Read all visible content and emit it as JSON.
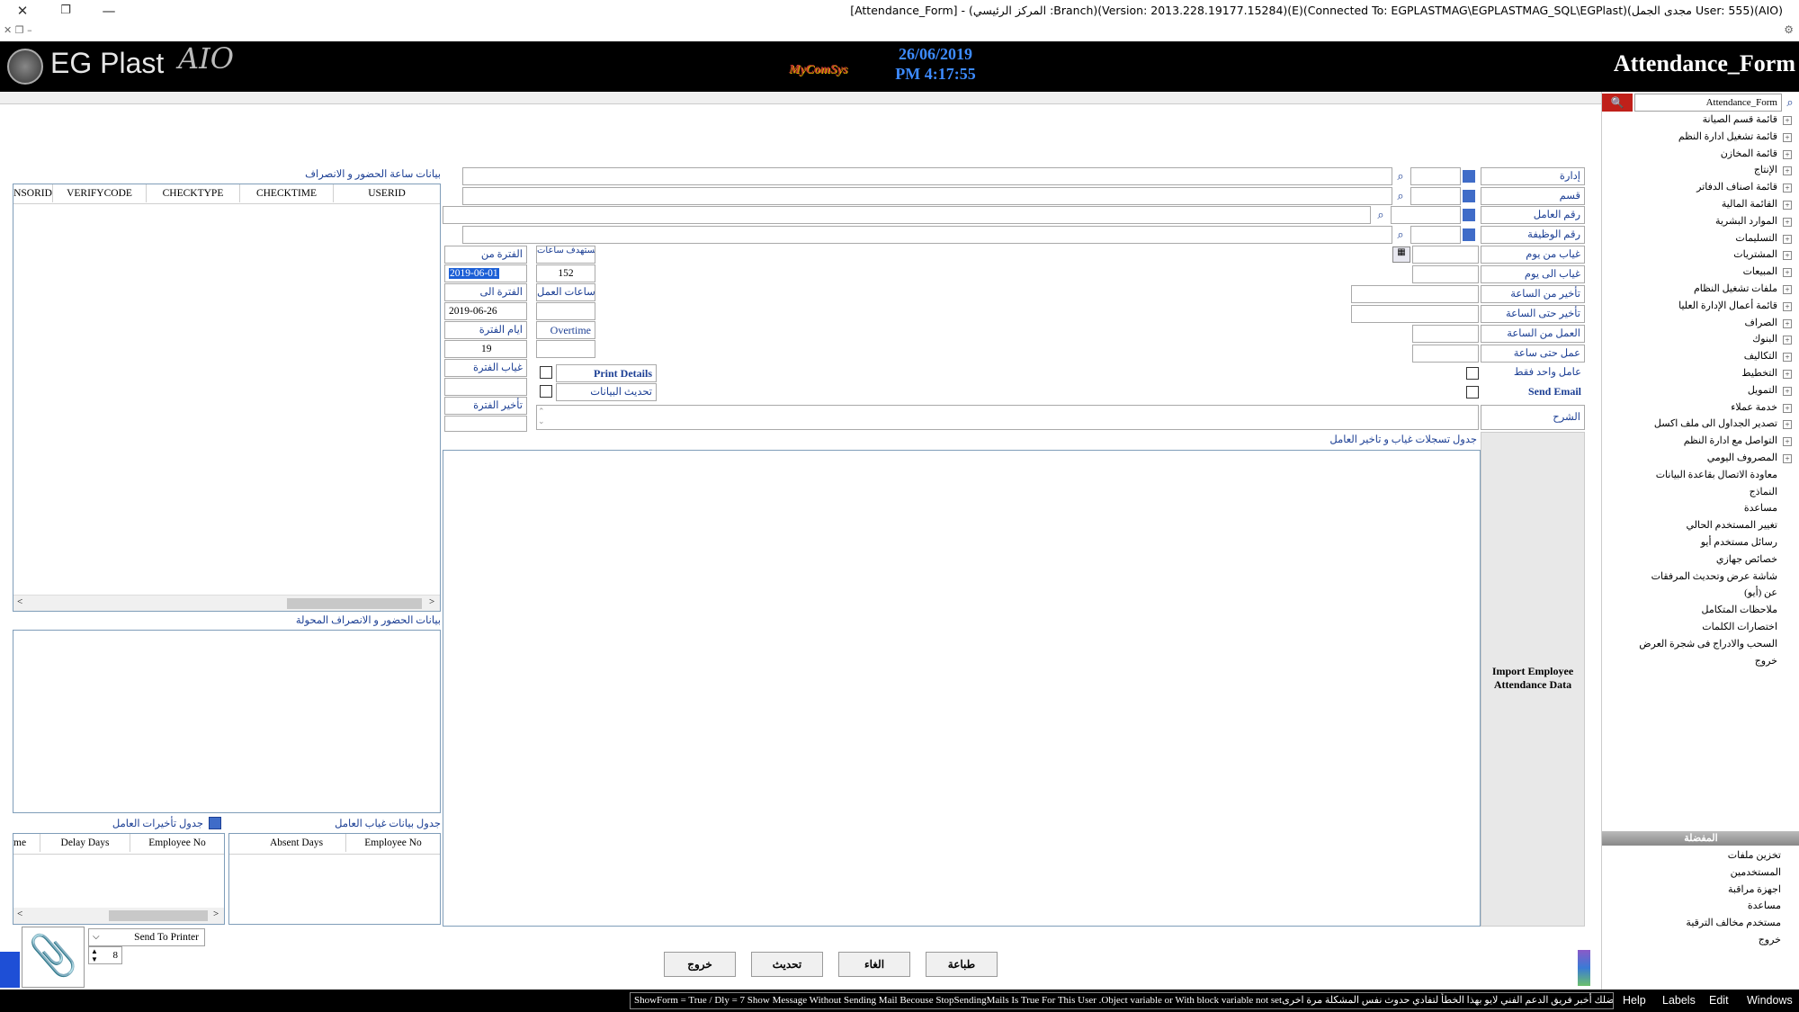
{
  "window": {
    "title": "[Attendance_Form] - (المركز الرئيسي :Branch)(Version: 2013.228.19177.15284)(E)(Connected To: EGPLASTMAG\\EGPLASTMAG_SQL\\EGPlast)(مجدى الجمل User: 555)(AIO)"
  },
  "header": {
    "logo": "EG Plast",
    "logo_suffix": "AIO",
    "brand": "MyComSys",
    "date": "26/06/2019",
    "time": "PM 4:17:55",
    "form_title": "Attendance_Form"
  },
  "left": {
    "att_title": "بيانات ساعة الحضور و الانصراف",
    "att_columns": [
      "NSORID",
      "VERIFYCODE",
      "CHECKTYPE",
      "CHECKTIME",
      "USERID"
    ],
    "transferred_title": "بيانات الحضور و الانصراف المحولة",
    "delays_title": "جدول تأخيرات العامل",
    "delays_columns": [
      "me",
      "Delay Days",
      "Employee No"
    ],
    "absence_title": "جدول بيانات غياب العامل",
    "absence_columns": [
      "Absent Days",
      "Employee No"
    ]
  },
  "form": {
    "labels": {
      "department": "إدارة",
      "section": "قسم",
      "employee_no": "رقم العامل",
      "job_no": "رقم الوظيفة",
      "absent_from": "غياب من يوم",
      "absent_to": "غياب الى يوم",
      "delay_from": "تأخير من الساعة",
      "delay_to": "تأخير حتى الساعة",
      "work_from": "العمل من الساعة",
      "work_to": "عمل حتى ساعة",
      "single_worker": "عامل واحد فقط",
      "send_email": "Send Email",
      "explanation": "الشرح"
    },
    "mid": {
      "period_from_label": "الفترة من",
      "period_from": "2019-06-01",
      "period_to_label": "الفترة الى",
      "period_to": "2019-06-26",
      "period_days_label": "ايام الفترة",
      "period_days": "19",
      "period_absence_label": "غياب الفترة",
      "period_delay_label": "تأخير الفترة",
      "required_hours_label": "مستهدف ساعات",
      "required_hours": "152",
      "work_hours_label": "ساعات العمل",
      "overtime_label": "Overtime",
      "print_details": "Print Details",
      "update_data": "تحديث البيانات"
    },
    "grid_title": "جدول تسجلات غياب و تاخير العامل",
    "import_label": "Import Employee Attendance Data"
  },
  "buttons": {
    "exit": "خروج",
    "refresh": "تحديث",
    "cancel": "الغاء",
    "print": "طباعة",
    "send_to_printer": "Send To Printer",
    "copies": "8"
  },
  "tree": {
    "search_value": "Attendance_Form",
    "items": [
      "قائمة قسم الصيانة",
      "قائمة تشغيل ادارة النظم",
      "قائمة المخازن",
      "الإنتاج",
      "قائمة اصناف الدفاتر",
      "القائمة المالية",
      "الموارد البشرية",
      "التسليمات",
      "المشتريات",
      "المبيعات",
      "ملفات تشغيل النظام",
      "قائمة أعمال الإدارة العليا",
      "الصراف",
      "البنوك",
      "التكاليف",
      "التخطيط",
      "التمويل",
      "خدمة عملاء",
      "تصدير الجداول الى ملف اكسل",
      "التواصل مع ادارة النظم",
      "المصروف اليومي",
      "معاودة الاتصال بقاعدة البيانات",
      "النماذج",
      "مساعدة",
      "تغيير المستخدم الحالي",
      "رسائل مستخدم أيو",
      "خصائص جهازي",
      "شاشة عرض وتحديث المرفقات",
      "عن (أيو)",
      "ملاحظات المتكامل",
      "اختصارات الكلمات",
      "السحب والادراج فى شجرة العرض",
      "خروج"
    ],
    "favorites_title": "المفضلة",
    "favorites": [
      "تخزين ملفات",
      "المستخدمين",
      "اجهزة مراقبة",
      "مساعدة",
      "مستخدم مخالف الترقية",
      "خروج"
    ]
  },
  "status": {
    "message": "ShowForm = True / Dly = 7 Show Message Without Sending Mail Becouse StopSendingMails Is True For This User .Object variable or With block variable not setمن فضلك أخبر فريق الدعم الفني لايو بهذا الخطأ لتفادي حدوث نفس المشكلة مرة اخرى",
    "menus": [
      "Help",
      "Labels",
      "Edit",
      "Windows"
    ]
  }
}
